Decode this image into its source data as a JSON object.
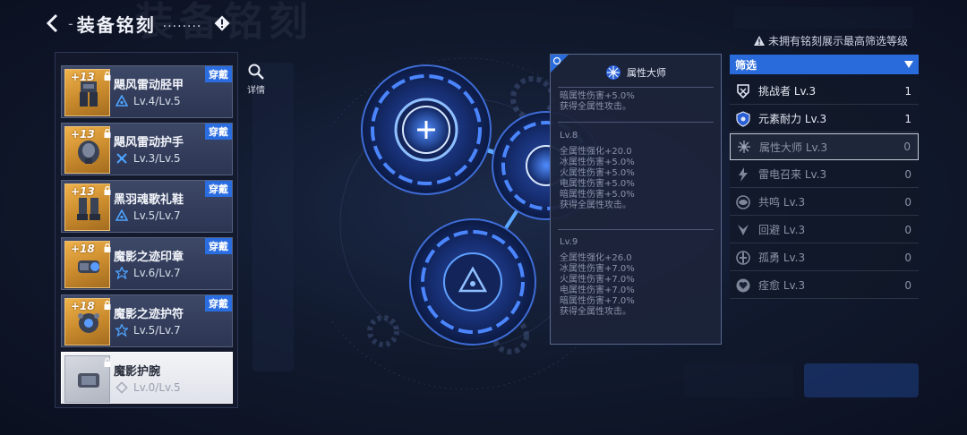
{
  "header": {
    "title": "装备铭刻",
    "dots": "........",
    "bg_title": "装备铭刻"
  },
  "detail_label": "详情",
  "equipment": [
    {
      "name": "飓风雷动胫甲",
      "enhance": "+13",
      "level": "Lv.4/Lv.5",
      "badge": "穿戴",
      "selected": false
    },
    {
      "name": "飓风雷动护手",
      "enhance": "+13",
      "level": "Lv.3/Lv.5",
      "badge": "穿戴",
      "selected": false
    },
    {
      "name": "黑羽魂歌礼鞋",
      "enhance": "+13",
      "level": "Lv.5/Lv.7",
      "badge": "穿戴",
      "selected": false
    },
    {
      "name": "魔影之迹印章",
      "enhance": "+18",
      "level": "Lv.6/Lv.7",
      "badge": "穿戴",
      "selected": false
    },
    {
      "name": "魔影之迹护符",
      "enhance": "+18",
      "level": "Lv.5/Lv.7",
      "badge": "穿戴",
      "selected": false
    },
    {
      "name": "魔影护腕",
      "enhance": "",
      "level": "Lv.0/Lv.5",
      "badge": "",
      "selected": true
    }
  ],
  "tooltip": {
    "title": "属性大师",
    "section1": [
      "暗属性伤害+5.0%",
      "获得全属性攻击。"
    ],
    "section2": [
      "Lv.8",
      "全属性强化+20.0",
      "冰属性伤害+5.0%",
      "火属性伤害+5.0%",
      "电属性伤害+5.0%",
      "暗属性伤害+5.0%",
      "获得全属性攻击。"
    ],
    "section3": [
      "Lv.9",
      "全属性强化+26.0",
      "冰属性伤害+7.0%",
      "火属性伤害+7.0%",
      "电属性伤害+7.0%",
      "暗属性伤害+7.0%",
      "获得全属性攻击。"
    ]
  },
  "notice": "未拥有铭刻展示最高筛选等级",
  "filter": {
    "label": "筛选",
    "items": [
      {
        "name": "挑战者 Lv.3",
        "count": "1",
        "icon": "challenger-icon",
        "active": false,
        "dim": false
      },
      {
        "name": "元素耐力 Lv.3",
        "count": "1",
        "icon": "shield-icon",
        "active": false,
        "dim": false
      },
      {
        "name": "属性大师 Lv.3",
        "count": "0",
        "icon": "attribute-master-icon",
        "active": true,
        "dim": true
      },
      {
        "name": "雷电召来 Lv.3",
        "count": "0",
        "icon": "lightning-icon",
        "active": false,
        "dim": true
      },
      {
        "name": "共鸣 Lv.3",
        "count": "0",
        "icon": "resonance-icon",
        "active": false,
        "dim": true
      },
      {
        "name": "回避 Lv.3",
        "count": "0",
        "icon": "evade-icon",
        "active": false,
        "dim": true
      },
      {
        "name": "孤勇 Lv.3",
        "count": "0",
        "icon": "lone-brave-icon",
        "active": false,
        "dim": true
      },
      {
        "name": "痊愈 Lv.3",
        "count": "0",
        "icon": "heal-icon",
        "active": false,
        "dim": true
      }
    ]
  },
  "colors": {
    "accent_blue": "#2a6bdc",
    "badge_blue": "#2a6de0",
    "gold_rarity": "#f0b24a"
  }
}
